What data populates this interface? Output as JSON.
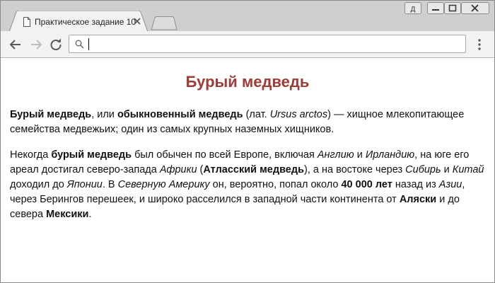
{
  "browser": {
    "tab_title": "Практическое задание 10",
    "address_value": "",
    "colors": {
      "titlebar": "#cfcfcf",
      "toolbar": "#f2f2f2",
      "heading": "#a23a37"
    },
    "icons": [
      "page-icon",
      "close-icon",
      "new-tab-icon",
      "user-icon",
      "minimize-icon",
      "maximize-icon",
      "window-close-icon",
      "back-icon",
      "forward-icon",
      "reload-icon",
      "search-icon",
      "menu-icon"
    ],
    "window_controls": {
      "user_label": "Д"
    }
  },
  "page": {
    "heading": "Бурый медведь",
    "p1": {
      "t1": "Бурый медведь",
      "t2": ", или ",
      "t3": "обыкновенный медведь",
      "t4": " (лат. ",
      "t5": "Ursus arctos",
      "t6": ") — хищное млекопитающее семейства медвежьих; один из самых крупных наземных хищников."
    },
    "p2": {
      "t1": "Некогда ",
      "t2": "бурый медведь",
      "t3": " был обычен по всей Европе, включая ",
      "t4": "Англию",
      "t5": " и ",
      "t6": "Ирландию",
      "t7": ", на юге его ареал достигал северо-запада ",
      "t8": "Африки",
      "t9": " (",
      "t10": "Атласский медведь",
      "t11": "), а на востоке через ",
      "t12": "Сибирь",
      "t13": " и ",
      "t14": "Китай",
      "t15": " доходил до ",
      "t16": "Японии",
      "t17": ". В ",
      "t18": "Северную Америку",
      "t19": " он, вероятно, попал около ",
      "t20": "40 000 лет",
      "t21": " назад из ",
      "t22": "Азии",
      "t23": ", через Берингов перешеек, и широко расселился в западной части континента от ",
      "t24": "Аляски",
      "t25": " и до севера ",
      "t26": "Мексики",
      "t27": "."
    }
  }
}
